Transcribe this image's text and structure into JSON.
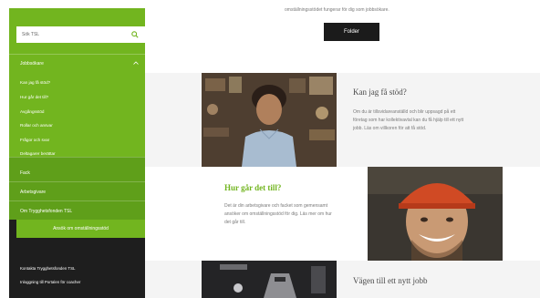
{
  "sidebar": {
    "search_placeholder": "Sök TSL",
    "section_title": "Jobbsökare",
    "sub_items": [
      {
        "label": "Kan jag få stöd?"
      },
      {
        "label": "Hur går det till?"
      },
      {
        "label": "Avgångsstöd"
      },
      {
        "label": "Rollar och ansvar"
      },
      {
        "label": "Frågor och svar"
      },
      {
        "label": "Deltagarer berättar"
      }
    ],
    "main_items": [
      {
        "label": "Fack"
      },
      {
        "label": "Arbetsgivare"
      },
      {
        "label": "Om Trygghetsfonden TSL"
      }
    ],
    "cta_label": "Ansök om omställningsstöd",
    "footer_links": [
      {
        "label": "Kontakta Trygghetsfonden TSL"
      },
      {
        "label": "Inloggning till Portalen för coacher"
      }
    ]
  },
  "main": {
    "top_text": "omställningsstödet fungerar för dig som jobbsökare.",
    "folder_button": "Folder",
    "cards": [
      {
        "title": "Kan jag få stöd?",
        "body": "Om du är tillsvidareanställd och blir uppsagd på ett företag som har kollektivavtal kan du få hjälp till ett nytt jobb. Läs om villkoren för att få stöd."
      },
      {
        "title": "Hur går det till?",
        "body": "Det är din arbetsgivare och facket som gemensamt ansöker om omställningsstöd för dig. Läs mer om hur det går till."
      },
      {
        "title": "Vägen till ett nytt jobb",
        "body": ""
      }
    ]
  },
  "colors": {
    "green": "#72b51f",
    "green_dark": "#5f9f1a",
    "sidebar_dark": "#1e1e1e",
    "band_gray": "#f4f4f4"
  }
}
